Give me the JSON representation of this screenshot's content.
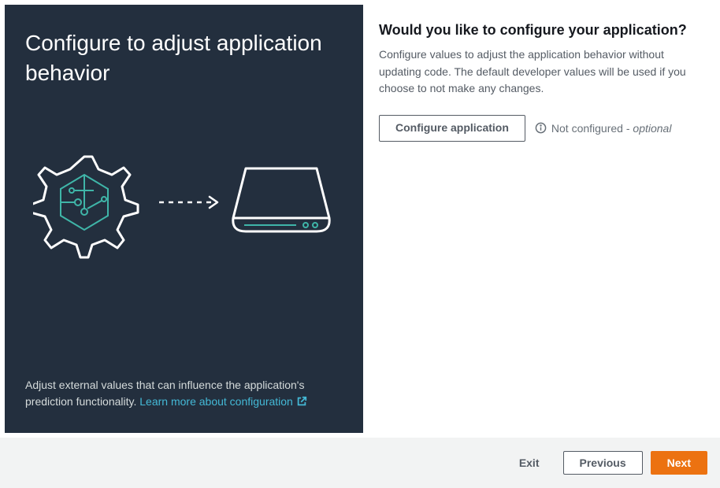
{
  "left": {
    "title": "Configure to adjust application behavior",
    "description_prefix": "Adjust external values that can influence the application's prediction functionality. ",
    "link_text": "Learn more about configuration"
  },
  "right": {
    "title": "Would you like to configure your application?",
    "description": "Configure values to adjust the application behavior without updating code. The default developer values will be used if you choose to not make any changes.",
    "configure_button": "Configure application",
    "status_label": "Not configured",
    "status_separator": " - ",
    "status_optional": "optional"
  },
  "footer": {
    "exit": "Exit",
    "previous": "Previous",
    "next": "Next"
  },
  "colors": {
    "dark_bg": "#232f3e",
    "accent_teal": "#44b9d6",
    "primary_orange": "#ec7211"
  }
}
